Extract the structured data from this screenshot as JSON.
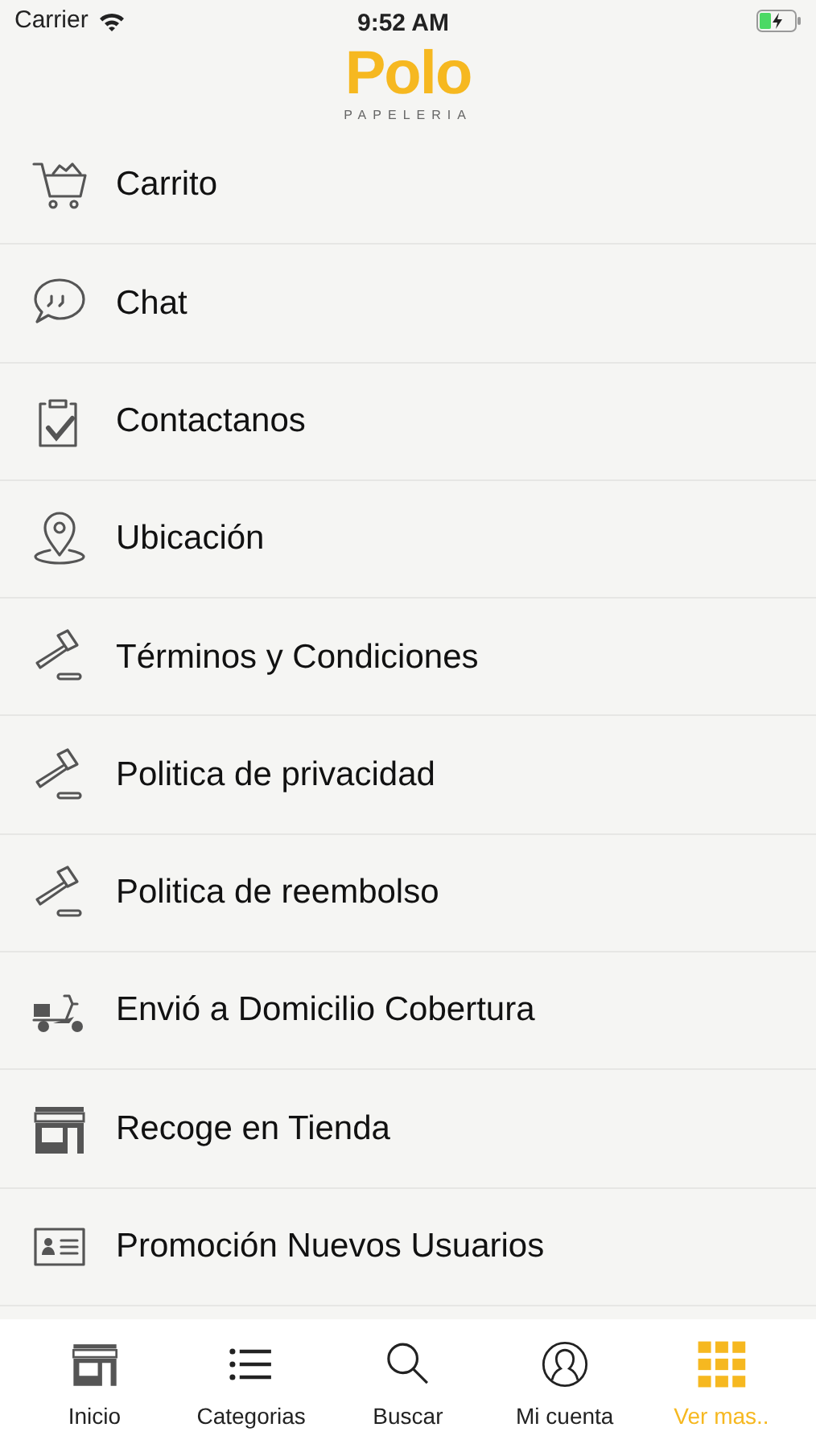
{
  "status_bar": {
    "carrier": "Carrier",
    "time": "9:52 AM"
  },
  "header": {
    "logo": "Polo",
    "tagline": "PAPELERIA"
  },
  "menu": [
    {
      "kind": "cart",
      "label": "Carrito"
    },
    {
      "kind": "chat",
      "label": "Chat"
    },
    {
      "kind": "clipboard",
      "label": "Contactanos"
    },
    {
      "kind": "pin",
      "label": "Ubicación"
    },
    {
      "kind": "gavel",
      "label": "Términos y Condiciones"
    },
    {
      "kind": "gavel",
      "label": "Politica de privacidad"
    },
    {
      "kind": "gavel",
      "label": "Politica de reembolso"
    },
    {
      "kind": "scooter",
      "label": "Envió a Domicilio Cobertura"
    },
    {
      "kind": "store",
      "label": "Recoge en Tienda"
    },
    {
      "kind": "card",
      "label": "Promoción Nuevos Usuarios"
    }
  ],
  "tab_bar": [
    {
      "kind": "store",
      "label": "Inicio",
      "selected": false
    },
    {
      "kind": "list",
      "label": "Categorias",
      "selected": false
    },
    {
      "kind": "search",
      "label": "Buscar",
      "selected": false
    },
    {
      "kind": "user",
      "label": "Mi cuenta",
      "selected": false
    },
    {
      "kind": "grid",
      "label": "Ver mas..",
      "selected": true
    }
  ]
}
